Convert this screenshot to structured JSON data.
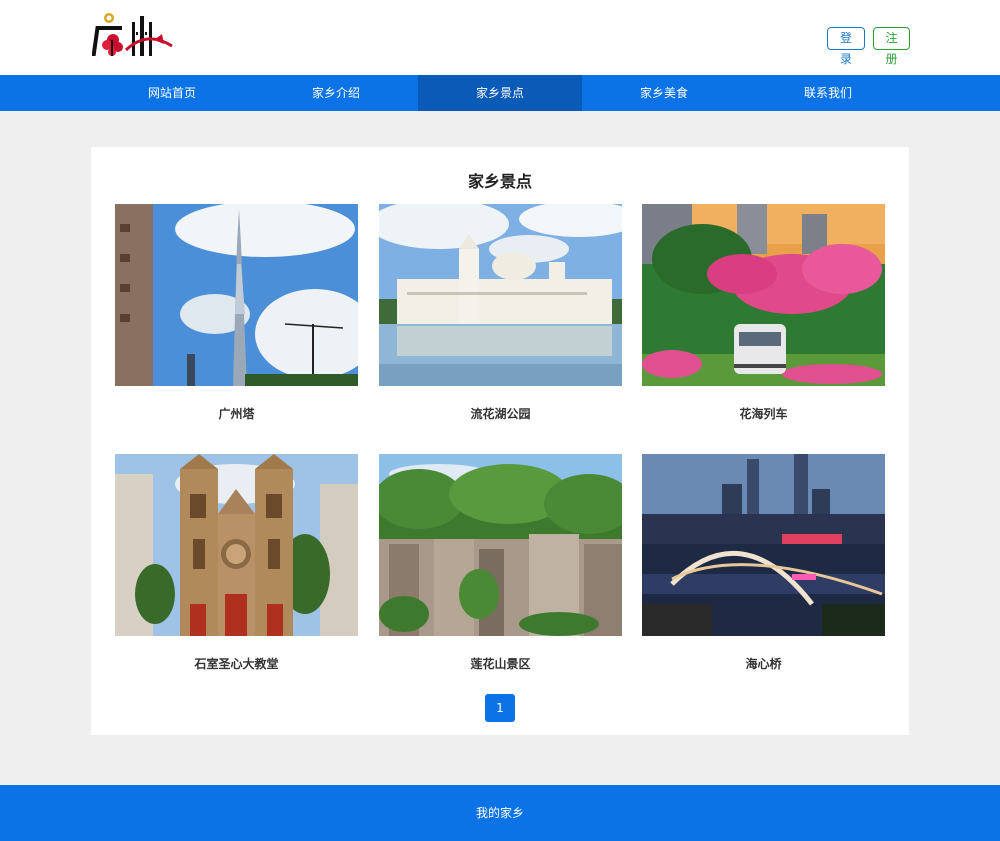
{
  "header": {
    "logo_alt": "广州",
    "login_label": "登录",
    "register_label": "注册"
  },
  "nav": {
    "items": [
      {
        "label": "网站首页"
      },
      {
        "label": "家乡介绍"
      },
      {
        "label": "家乡景点"
      },
      {
        "label": "家乡美食"
      },
      {
        "label": "联系我们"
      }
    ],
    "active": "家乡景点"
  },
  "main": {
    "title": "家乡景点",
    "spots": [
      {
        "name": "广州塔"
      },
      {
        "name": "流花湖公园"
      },
      {
        "name": "花海列车"
      },
      {
        "name": "石室圣心大教堂"
      },
      {
        "name": "莲花山景区"
      },
      {
        "name": "海心桥"
      }
    ],
    "pagination": {
      "current": "1"
    }
  },
  "footer": {
    "text": "我的家乡"
  },
  "colors": {
    "primary": "#0b73e6",
    "nav_active": "#0a5ab8",
    "login_border": "#1a78c8",
    "register_border": "#2e9e3a",
    "page_bg": "#efefef"
  }
}
